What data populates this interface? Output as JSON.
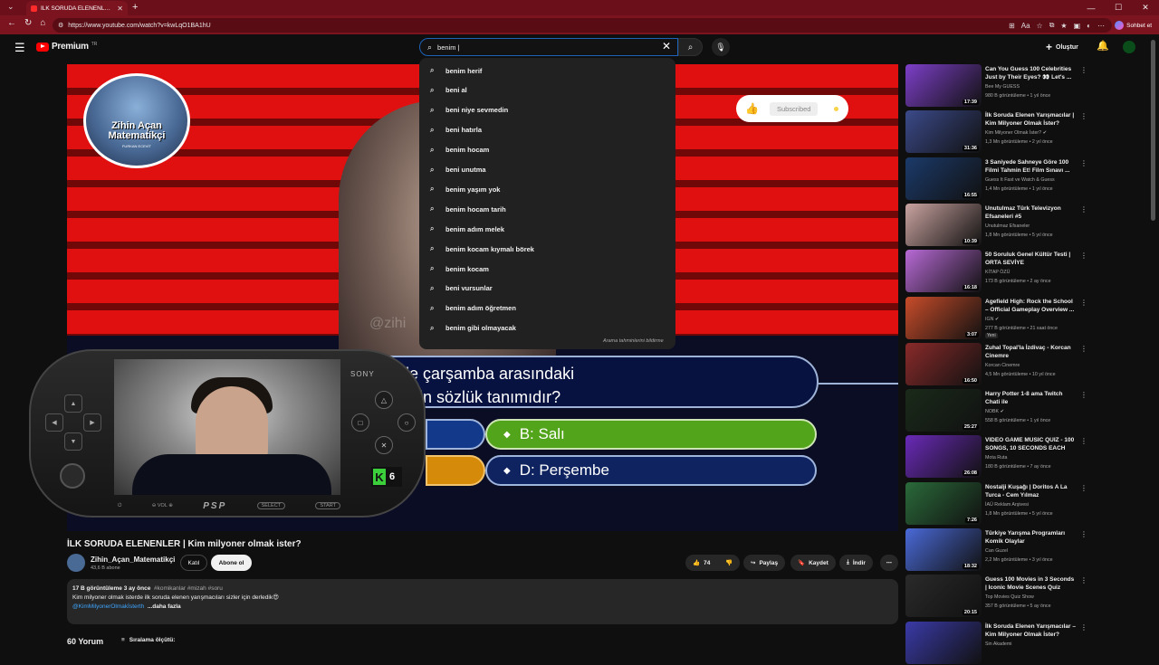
{
  "browser": {
    "tab_title": "İLK SORUDA ELENENLER | Kim mil",
    "url": "https://www.youtube.com/watch?v=kwLqO1BA1hU",
    "profile_label": "Sohbet et"
  },
  "header": {
    "brand": "Premium",
    "brand_region": "TR",
    "search_value": "benim |",
    "create_label": "Oluştur"
  },
  "suggestions": [
    "benim herif",
    "beni al",
    "beni niye sevmedin",
    "beni hatırla",
    "benim hocam",
    "beni unutma",
    "benim yaşım yok",
    "benim hocam tarih",
    "benim adım melek",
    "benim kocam kıymalı börek",
    "benim kocam",
    "beni vursunlar",
    "benim adım öğretmen",
    "benim gibi olmayacak"
  ],
  "suggestions_footer": "Arama tahminlerini bildirme",
  "overlay": {
    "channel_badge_line1": "Zihin Açan",
    "channel_badge_line2": "Matematikçi",
    "channel_badge_sub": "FURKAN ECEVİT",
    "subscribed_label": "Subscribed",
    "watermark": "@zihi",
    "question_line1": "si ile çarşamba arasındaki",
    "question_line2": "nisinin sözlük tanımıdır?",
    "answer_b": "B: Salı",
    "answer_d": "D: Perşembe",
    "psp_brand": "SONY",
    "psp_logo": "PSP",
    "psp_vol": "VOL",
    "psp_select": "SELECT",
    "psp_start": "START",
    "k_letter": "K",
    "k_number": "6"
  },
  "video": {
    "title": "İLK SORUDA ELENENLER | Kim milyoner olmak ister?",
    "channel": "Zihin_Açan_Matematikçi",
    "subscribers": "43,6 B abone",
    "join_label": "Katıl",
    "subscribe_label": "Abone ol",
    "likes": "74",
    "share_label": "Paylaş",
    "save_label": "Kaydet",
    "download_label": "İndir",
    "views_date": "17 B görüntüleme  3 ay önce",
    "tags": "#komikanlar #mizah #soru",
    "description": "Kim milyoner olmak isterde ilk soruda elenen yarışmacıları sizler için derledik😍",
    "desc_link": "@KimMilyonerOlmakİsterth",
    "more_label": "...daha fazla",
    "comments_count": "60 Yorum",
    "sort_label": "Sıralama ölçütü:"
  },
  "recommendations": [
    {
      "title": "Can You Guess 100 Celebrities Just by Their Eyes? 👀 Let's ...",
      "channel": "Bee My GUESS",
      "meta": "980 B görüntüleme • 1 yıl önce",
      "duration": "17:39",
      "color": "#7d3fc8"
    },
    {
      "title": "İlk Soruda Elenen Yarışmacılar | Kim Milyoner Olmak İster?",
      "channel": "Kim Milyoner Olmak İster? ✔",
      "meta": "1,3 Mn görüntüleme • 2 yıl önce",
      "duration": "31:36",
      "color": "#3b4a8a"
    },
    {
      "title": "3 Saniyede Sahneye Göre 100 Filmi Tahmin Et! Film Sınavı ...",
      "channel": "Guess It Fast ve Watch & Guess",
      "meta": "1,4 Mn görüntüleme • 1 yıl önce",
      "duration": "16:55",
      "color": "#1b3a6a"
    },
    {
      "title": "Unutulmaz Türk Televizyon Efsaneleri #5",
      "channel": "Unutulmaz Efsaneler",
      "meta": "1,8 Mn görüntüleme • 5 yıl önce",
      "duration": "10:39",
      "color": "#c9a3a0"
    },
    {
      "title": "50 Soruluk Genel Kültür Testi | ORTA SEVİYE",
      "channel": "KİTAP ÖZÜ",
      "meta": "173 B görüntüleme • 2 ay önce",
      "duration": "16:18",
      "color": "#b86ad6"
    },
    {
      "title": "Agefield High: Rock the School – Official Gameplay Overview ...",
      "channel": "IGN ✔",
      "meta": "277 B görüntüleme • 21 saat önce",
      "duration": "3:07",
      "color": "#c84c2a",
      "badge": "Yeni"
    },
    {
      "title": "Zuhal Topal'la İzdivaç - Korcan Cinemre",
      "channel": "Korcan Cinemre",
      "meta": "4,5 Mn görüntüleme • 10 yıl önce",
      "duration": "16:50",
      "color": "#8a2a2a"
    },
    {
      "title": "Harry Potter 1-8 ama Twitch Chati ile",
      "channel": "NOBK ✔",
      "meta": "558 B görüntüleme • 1 yıl önce",
      "duration": "25:27",
      "color": "#1a2a1a"
    },
    {
      "title": "VIDEO GAME MUSIC QUIZ - 100 SONGS, 10 SECONDS EACH",
      "channel": "Mota Ruta",
      "meta": "180 B görüntüleme • 7 ay önce",
      "duration": "26:08",
      "color": "#6a2ab8"
    },
    {
      "title": "Nostalji Kuşağı | Doritos A La Turca - Cem Yılmaz",
      "channel": "İAÜ Reklam Arşivesi",
      "meta": "1,8 Mn görüntüleme • 5 yıl önce",
      "duration": "7:26",
      "color": "#2a6a3a"
    },
    {
      "title": "Türkiye Yarışma Programları Komik Olaylar",
      "channel": "Can Guzel",
      "meta": "2,2 Mn görüntüleme • 3 yıl önce",
      "duration": "18:32",
      "color": "#4a6ad8"
    },
    {
      "title": "Guess 100 Movies in 3 Seconds | Iconic Movie Scenes Quiz",
      "channel": "Top Movies Quiz Show",
      "meta": "357 B görüntüleme • 5 ay önce",
      "duration": "20:15",
      "color": "#2a2a2a"
    },
    {
      "title": "İlk Soruda Elenen Yarışmacılar – Kim Milyoner Olmak İster?",
      "channel": "Sin Akademi",
      "meta": "",
      "duration": "",
      "color": "#3a3aa8"
    }
  ]
}
